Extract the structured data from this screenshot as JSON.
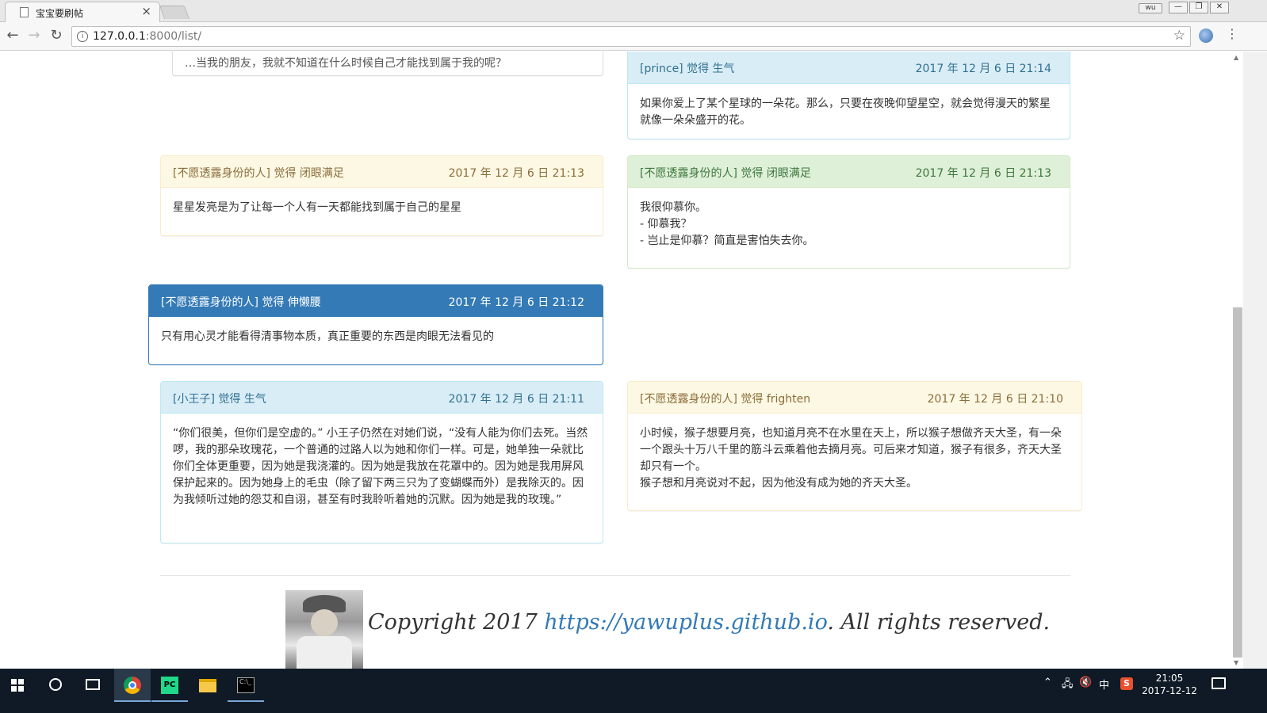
{
  "browser": {
    "tab_title": "宝宝要刷帖",
    "tab_close": "×",
    "url_host": "127.0.0.1",
    "url_path": ":8000/list/",
    "user_badge": "wu"
  },
  "posts": [
    {
      "id": "p0",
      "style": "default",
      "header_left": "",
      "header_right": "",
      "body": "…当我的朋友，我就不知道在什么时候自己才能找到属于我的呢？"
    },
    {
      "id": "p1",
      "style": "info",
      "header_left": "[prince] 觉得 生气",
      "header_right": "2017 年 12 月 6 日 21:14",
      "body": "如果你爱上了某个星球的一朵花。那么，只要在夜晚仰望星空，就会觉得漫天的繁星就像一朵朵盛开的花。"
    },
    {
      "id": "p2",
      "style": "warning",
      "header_left": "[不愿透露身份的人] 觉得 闭眼满足",
      "header_right": "2017 年 12 月 6 日 21:13",
      "body": "星星发亮是为了让每一个人有一天都能找到属于自己的星星"
    },
    {
      "id": "p3",
      "style": "success",
      "header_left": "[不愿透露身份的人] 觉得 闭眼满足",
      "header_right": "2017 年 12 月 6 日 21:13",
      "body_lines": [
        "我很仰慕你。",
        "- 仰慕我？",
        "- 岂止是仰慕？简直是害怕失去你。"
      ]
    },
    {
      "id": "p4",
      "style": "primary",
      "header_left": "[不愿透露身份的人] 觉得 伸懒腰",
      "header_right": "2017 年 12 月 6 日 21:12",
      "body": "只有用心灵才能看得清事物本质，真正重要的东西是肉眼无法看见的"
    },
    {
      "id": "p5",
      "style": "info",
      "header_left": "[小王子] 觉得 生气",
      "header_right": "2017 年 12 月 6 日 21:11",
      "body": "“你们很美，但你们是空虚的。” 小王子仍然在对她们说，“没有人能为你们去死。当然啰，我的那朵玫瑰花，一个普通的过路人以为她和你们一样。可是，她单独一朵就比你们全体更重要，因为她是我浇灌的。因为她是我放在花罩中的。因为她是我用屏风保护起来的。因为她身上的毛虫（除了留下两三只为了变蝴蝶而外）是我除灭的。因为我倾听过她的怨艾和自诩，甚至有时我聆听着她的沉默。因为她是我的玫瑰。”"
    },
    {
      "id": "p6",
      "style": "warning",
      "header_left": "[不愿透露身份的人] 觉得 frighten",
      "header_right": "2017 年 12 月 6 日 21:10",
      "body_lines": [
        "小时候，猴子想要月亮，也知道月亮不在水里在天上，所以猴子想做齐天大圣，有一朵一个跟头十万八千里的筋斗云乘着他去摘月亮。可后来才知道，猴子有很多，齐天大圣却只有一个。",
        "猴子想和月亮说对不起，因为他没有成为她的齐天大圣。"
      ]
    }
  ],
  "footer": {
    "prefix": "Copyright 2017 ",
    "link": "https://yawuplus.github.io",
    "suffix": ". All rights reserved."
  },
  "taskbar": {
    "ime": "中",
    "time": "21:05",
    "date": "2017-12-12"
  }
}
